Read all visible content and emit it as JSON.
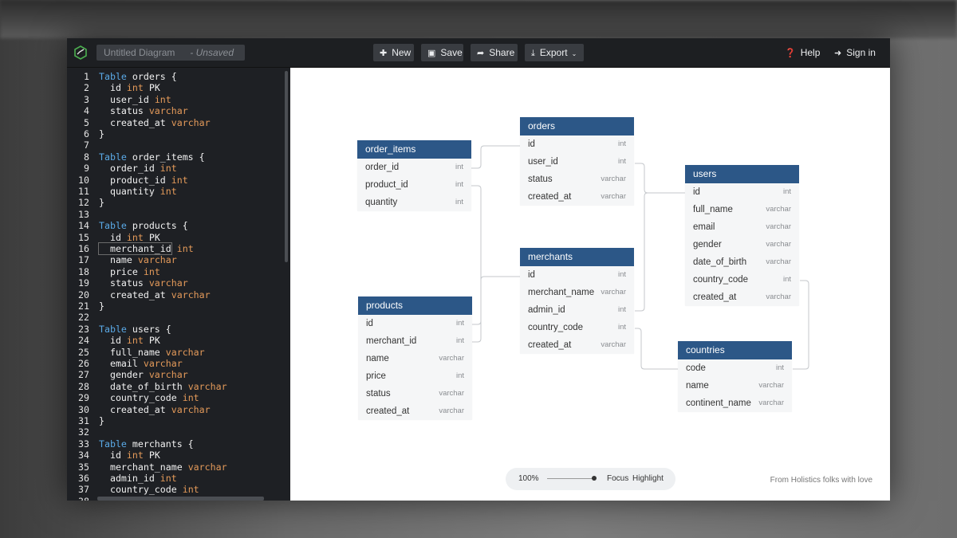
{
  "topbar": {
    "diagram_name": "Untitled Diagram",
    "unsaved": "- Unsaved",
    "new_label": "New",
    "save_label": "Save",
    "share_label": "Share",
    "export_label": "Export",
    "help_label": "Help",
    "signin_label": "Sign in"
  },
  "editor": {
    "lines": [
      {
        "n": "1",
        "kw": "Table",
        "rest": " orders {"
      },
      {
        "n": "2",
        "f": "  id",
        "t": "int",
        "x": " PK"
      },
      {
        "n": "3",
        "f": "  user_id",
        "t": "int"
      },
      {
        "n": "4",
        "f": "  status",
        "t": "varchar"
      },
      {
        "n": "5",
        "f": "  created_at",
        "t": "varchar"
      },
      {
        "n": "6",
        "rest": "}"
      },
      {
        "n": "7",
        "rest": ""
      },
      {
        "n": "8",
        "kw": "Table",
        "rest": " order_items {"
      },
      {
        "n": "9",
        "f": "  order_id",
        "t": "int"
      },
      {
        "n": "10",
        "f": "  product_id",
        "t": "int"
      },
      {
        "n": "11",
        "f": "  quantity",
        "t": "int"
      },
      {
        "n": "12",
        "rest": "}"
      },
      {
        "n": "13",
        "rest": ""
      },
      {
        "n": "14",
        "kw": "Table",
        "rest": " products {"
      },
      {
        "n": "15",
        "f": "  id",
        "t": "int",
        "x": " PK"
      },
      {
        "n": "16",
        "f": "  merchant_id",
        "t": "int"
      },
      {
        "n": "17",
        "f": "  name",
        "t": "varchar"
      },
      {
        "n": "18",
        "f": "  price",
        "t": "int"
      },
      {
        "n": "19",
        "f": "  status",
        "t": "varchar"
      },
      {
        "n": "20",
        "f": "  created_at",
        "t": "varchar"
      },
      {
        "n": "21",
        "rest": "}"
      },
      {
        "n": "22",
        "rest": ""
      },
      {
        "n": "23",
        "kw": "Table",
        "rest": " users {"
      },
      {
        "n": "24",
        "f": "  id",
        "t": "int",
        "x": " PK"
      },
      {
        "n": "25",
        "f": "  full_name",
        "t": "varchar"
      },
      {
        "n": "26",
        "f": "  email",
        "t": "varchar"
      },
      {
        "n": "27",
        "f": "  gender",
        "t": "varchar"
      },
      {
        "n": "28",
        "f": "  date_of_birth",
        "t": "varchar"
      },
      {
        "n": "29",
        "f": "  country_code",
        "t": "int"
      },
      {
        "n": "30",
        "f": "  created_at",
        "t": "varchar"
      },
      {
        "n": "31",
        "rest": "}"
      },
      {
        "n": "32",
        "rest": ""
      },
      {
        "n": "33",
        "kw": "Table",
        "rest": " merchants {"
      },
      {
        "n": "34",
        "f": "  id",
        "t": "int",
        "x": " PK"
      },
      {
        "n": "35",
        "f": "  merchant_name",
        "t": "varchar"
      },
      {
        "n": "36",
        "f": "  admin_id",
        "t": "int"
      },
      {
        "n": "37",
        "f": "  country_code",
        "t": "int"
      },
      {
        "n": "38",
        "rest": ""
      }
    ]
  },
  "tables": [
    {
      "name": "orders",
      "fields": [
        [
          "id",
          "int"
        ],
        [
          "user_id",
          "int"
        ],
        [
          "status",
          "varchar"
        ],
        [
          "created_at",
          "varchar"
        ]
      ]
    },
    {
      "name": "order_items",
      "fields": [
        [
          "order_id",
          "int"
        ],
        [
          "product_id",
          "int"
        ],
        [
          "quantity",
          "int"
        ]
      ]
    },
    {
      "name": "users",
      "fields": [
        [
          "id",
          "int"
        ],
        [
          "full_name",
          "varchar"
        ],
        [
          "email",
          "varchar"
        ],
        [
          "gender",
          "varchar"
        ],
        [
          "date_of_birth",
          "varchar"
        ],
        [
          "country_code",
          "int"
        ],
        [
          "created_at",
          "varchar"
        ]
      ]
    },
    {
      "name": "merchants",
      "fields": [
        [
          "id",
          "int"
        ],
        [
          "merchant_name",
          "varchar"
        ],
        [
          "admin_id",
          "int"
        ],
        [
          "country_code",
          "int"
        ],
        [
          "created_at",
          "varchar"
        ]
      ]
    },
    {
      "name": "products",
      "fields": [
        [
          "id",
          "int"
        ],
        [
          "merchant_id",
          "int"
        ],
        [
          "name",
          "varchar"
        ],
        [
          "price",
          "int"
        ],
        [
          "status",
          "varchar"
        ],
        [
          "created_at",
          "varchar"
        ]
      ]
    },
    {
      "name": "countries",
      "fields": [
        [
          "code",
          "int"
        ],
        [
          "name",
          "varchar"
        ],
        [
          "continent_name",
          "varchar"
        ]
      ]
    }
  ],
  "zoom": {
    "percent": "100%",
    "level": 0.95,
    "focus": "Focus",
    "highlight": "Highlight"
  },
  "credit": "From Holistics folks with love",
  "colors": {
    "header": "#2c5787",
    "accent_keyword": "#5aa9e6",
    "accent_type": "#e49a5a"
  }
}
